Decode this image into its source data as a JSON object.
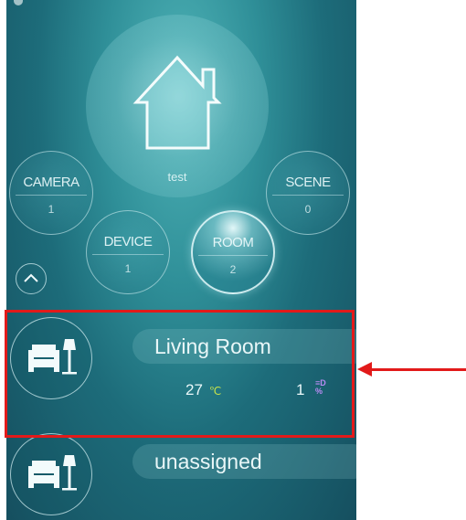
{
  "home": {
    "name": "test",
    "icon": "house-icon"
  },
  "stats": {
    "camera": {
      "label": "CAMERA",
      "count": "1"
    },
    "scene": {
      "label": "SCENE",
      "count": "0"
    },
    "device": {
      "label": "DEVICE",
      "count": "1"
    },
    "room": {
      "label": "ROOM",
      "count": "2",
      "active": true
    }
  },
  "collapse_icon": "chevron-up-icon",
  "rooms": [
    {
      "name": "Living Room",
      "temperature": "27",
      "temperature_unit": "℃",
      "device_count": "1",
      "device_icon": "device-signal-icon",
      "icon": "armchair-lamp-icon"
    },
    {
      "name": "unassigned",
      "icon": "armchair-lamp-icon"
    }
  ],
  "annotation": {
    "color": "#e21a1a"
  },
  "colors": {
    "background": "#1d6c7a",
    "temp_unit": "#c7e34a",
    "device_icon": "#b98bf3"
  }
}
